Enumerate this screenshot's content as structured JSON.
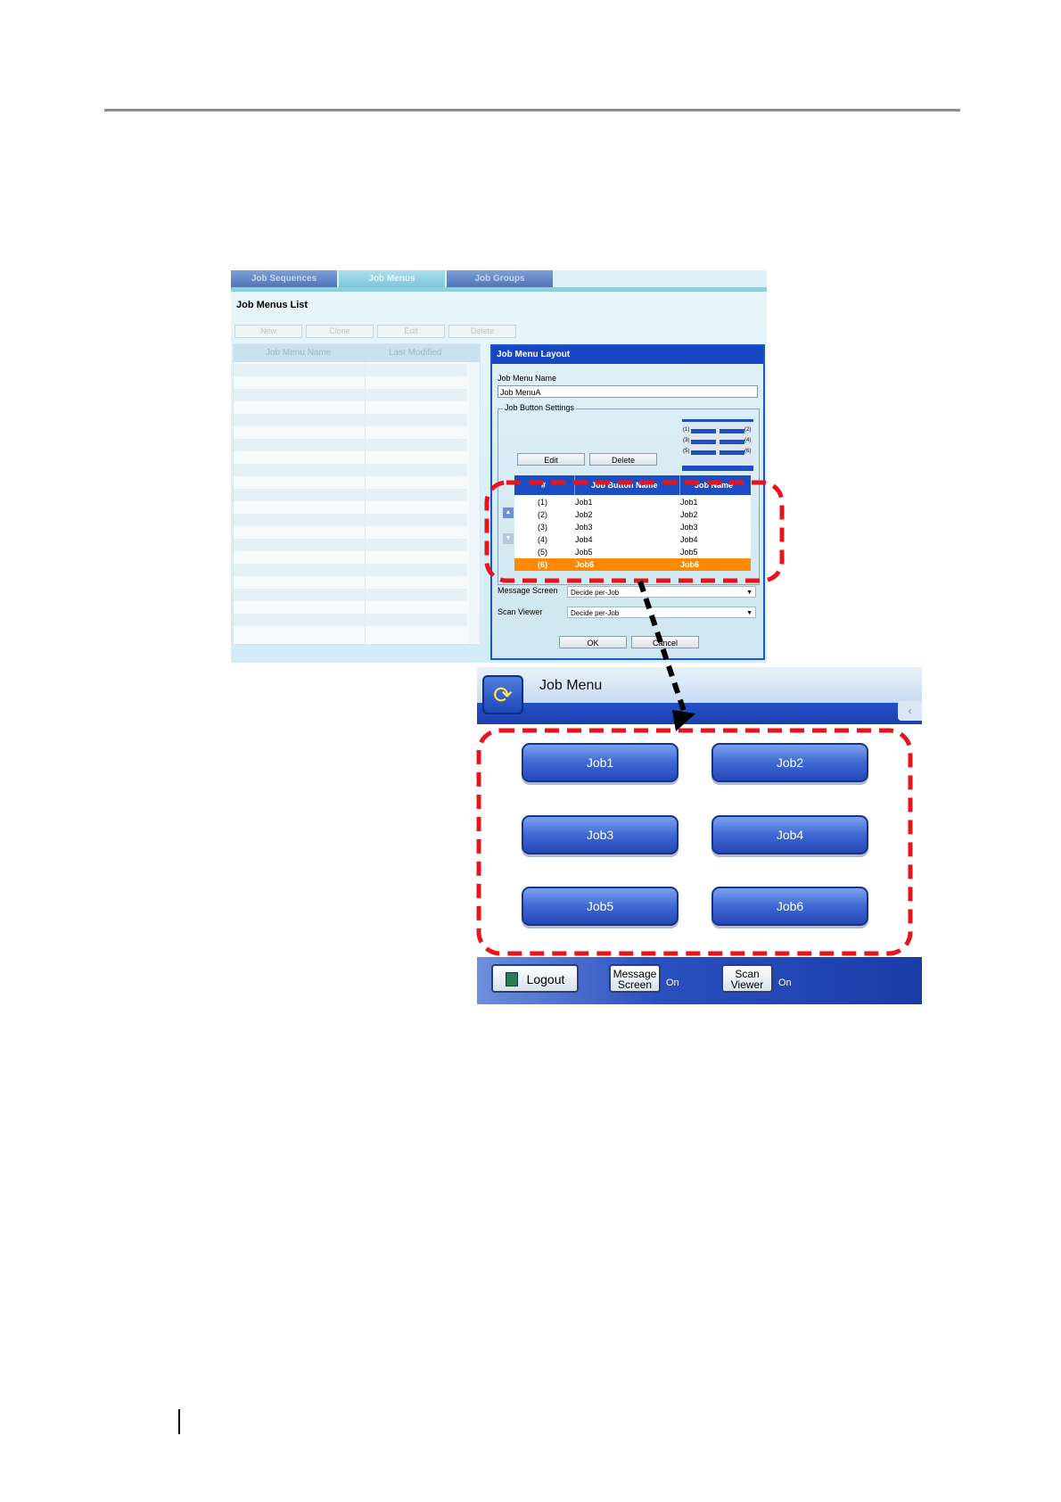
{
  "admin": {
    "tabs": [
      "Job Sequences",
      "Job Menus",
      "Job Groups"
    ],
    "list_title": "Job Menus List",
    "toolbar": [
      "New",
      "Clone",
      "Edit",
      "Delete"
    ],
    "list_columns": [
      "Job Menu Name",
      "Last Modified"
    ]
  },
  "dialog": {
    "title": "Job Menu Layout",
    "name_label": "Job Menu Name",
    "name_value": "Job MenuA",
    "group_label": "Job Button Settings",
    "mini_numbers": [
      "(1)",
      "(2)",
      "(3)",
      "(4)",
      "(5)",
      "(6)"
    ],
    "edit_label": "Edit",
    "delete_label": "Delete",
    "table_headers": [
      "#",
      "Job Button Name",
      "Job Name"
    ],
    "rows": [
      {
        "num": "(1)",
        "button": "Job1",
        "job": "Job1"
      },
      {
        "num": "(2)",
        "button": "Job2",
        "job": "Job2"
      },
      {
        "num": "(3)",
        "button": "Job3",
        "job": "Job3"
      },
      {
        "num": "(4)",
        "button": "Job4",
        "job": "Job4"
      },
      {
        "num": "(5)",
        "button": "Job5",
        "job": "Job5"
      },
      {
        "num": "(6)",
        "button": "Job6",
        "job": "Job6"
      }
    ],
    "selected_row": "(6)",
    "up_icon": "up-arrow-icon",
    "down_icon": "down-arrow-icon",
    "message_screen_label": "Message Screen",
    "message_screen_value": "Decide per-Job",
    "scan_viewer_label": "Scan Viewer",
    "scan_viewer_value": "Decide per-Job",
    "ok_label": "OK",
    "cancel_label": "Cancel"
  },
  "panel": {
    "title": "Job Menu",
    "home_icon": "refresh-arrows-icon",
    "buttons": [
      "Job1",
      "Job2",
      "Job3",
      "Job4",
      "Job5",
      "Job6"
    ],
    "logout_label": "Logout",
    "logout_icon": "door-icon",
    "message_screen_line1": "Message",
    "message_screen_line2": "Screen",
    "message_screen_state": "On",
    "scan_viewer_line1": "Scan",
    "scan_viewer_line2": "Viewer",
    "scan_viewer_state": "On"
  },
  "colors": {
    "highlight_dash": "#e8141c",
    "selected_row": "#ff8a00",
    "header_blue": "#1646c2"
  }
}
